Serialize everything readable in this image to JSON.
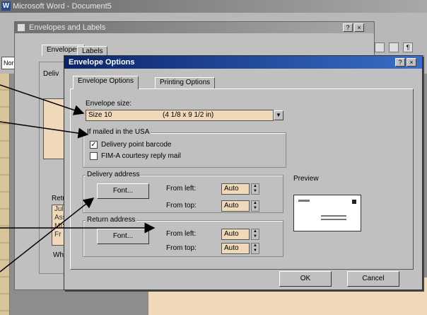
{
  "word": {
    "title": "Microsoft Word - Document5",
    "logo": "W",
    "style_box": "Norm"
  },
  "env_dialog": {
    "title": "Envelopes and Labels",
    "tabs": [
      "Envelopes",
      "Labels"
    ],
    "delivery_label": "Deliv",
    "return_label": "Retur",
    "return_lines": [
      "Juli",
      "Ass",
      "MIS",
      "Fr"
    ],
    "when_label": "Wher",
    "title_buttons": [
      "?",
      "×"
    ]
  },
  "opt_dialog": {
    "title": "Envelope Options",
    "title_buttons": [
      "?",
      "×"
    ],
    "tabs": [
      "Envelope Options",
      "Printing Options"
    ],
    "envelope_size_label": "Envelope size:",
    "envelope_size_value": "Size 10",
    "envelope_size_dims": "(4 1/8 x 9 1/2 in)",
    "if_mailed_label": "If mailed in the USA",
    "checkbox_1": "Delivery point barcode",
    "checkbox_2": "FIM-A courtesy reply mail",
    "delivery_group": "Delivery address",
    "return_group": "Return address",
    "font_button": "Font...",
    "from_left": "From left:",
    "from_top": "From top:",
    "auto": "Auto",
    "preview_label": "Preview",
    "ok": "OK",
    "cancel": "Cancel"
  },
  "icons": [
    "word-logo-icon",
    "dropdown-arrow-icon",
    "checkbox-checked-icon",
    "checkbox-unchecked-icon",
    "spin-up-icon",
    "spin-down-icon",
    "help-icon",
    "close-icon"
  ],
  "colors": {
    "title_active": "#0a246a",
    "title_inactive": "#808080",
    "field_bg": "#f0d9b8",
    "dialog_bg": "#c0c0c0"
  }
}
